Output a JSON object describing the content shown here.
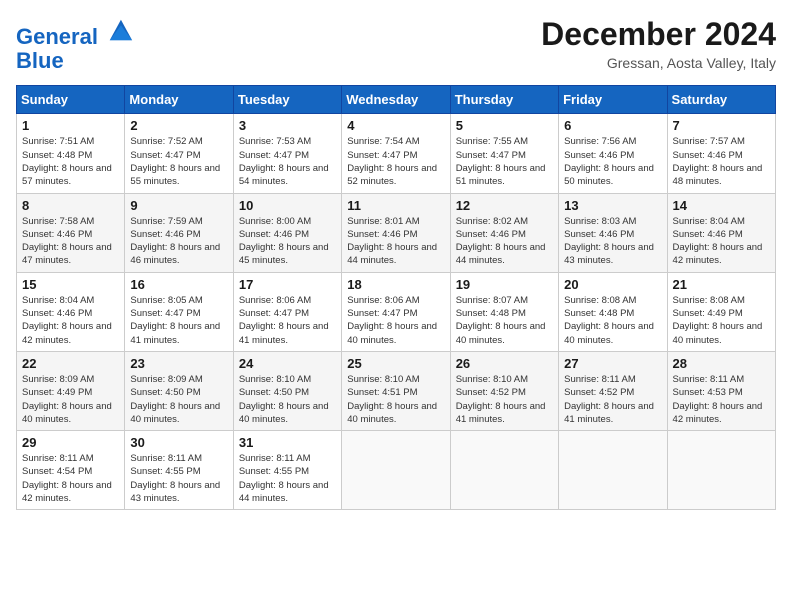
{
  "header": {
    "logo_line1": "General",
    "logo_line2": "Blue",
    "month_title": "December 2024",
    "location": "Gressan, Aosta Valley, Italy"
  },
  "weekdays": [
    "Sunday",
    "Monday",
    "Tuesday",
    "Wednesday",
    "Thursday",
    "Friday",
    "Saturday"
  ],
  "weeks": [
    [
      {
        "day": "1",
        "sunrise": "Sunrise: 7:51 AM",
        "sunset": "Sunset: 4:48 PM",
        "daylight": "Daylight: 8 hours and 57 minutes."
      },
      {
        "day": "2",
        "sunrise": "Sunrise: 7:52 AM",
        "sunset": "Sunset: 4:47 PM",
        "daylight": "Daylight: 8 hours and 55 minutes."
      },
      {
        "day": "3",
        "sunrise": "Sunrise: 7:53 AM",
        "sunset": "Sunset: 4:47 PM",
        "daylight": "Daylight: 8 hours and 54 minutes."
      },
      {
        "day": "4",
        "sunrise": "Sunrise: 7:54 AM",
        "sunset": "Sunset: 4:47 PM",
        "daylight": "Daylight: 8 hours and 52 minutes."
      },
      {
        "day": "5",
        "sunrise": "Sunrise: 7:55 AM",
        "sunset": "Sunset: 4:47 PM",
        "daylight": "Daylight: 8 hours and 51 minutes."
      },
      {
        "day": "6",
        "sunrise": "Sunrise: 7:56 AM",
        "sunset": "Sunset: 4:46 PM",
        "daylight": "Daylight: 8 hours and 50 minutes."
      },
      {
        "day": "7",
        "sunrise": "Sunrise: 7:57 AM",
        "sunset": "Sunset: 4:46 PM",
        "daylight": "Daylight: 8 hours and 48 minutes."
      }
    ],
    [
      {
        "day": "8",
        "sunrise": "Sunrise: 7:58 AM",
        "sunset": "Sunset: 4:46 PM",
        "daylight": "Daylight: 8 hours and 47 minutes."
      },
      {
        "day": "9",
        "sunrise": "Sunrise: 7:59 AM",
        "sunset": "Sunset: 4:46 PM",
        "daylight": "Daylight: 8 hours and 46 minutes."
      },
      {
        "day": "10",
        "sunrise": "Sunrise: 8:00 AM",
        "sunset": "Sunset: 4:46 PM",
        "daylight": "Daylight: 8 hours and 45 minutes."
      },
      {
        "day": "11",
        "sunrise": "Sunrise: 8:01 AM",
        "sunset": "Sunset: 4:46 PM",
        "daylight": "Daylight: 8 hours and 44 minutes."
      },
      {
        "day": "12",
        "sunrise": "Sunrise: 8:02 AM",
        "sunset": "Sunset: 4:46 PM",
        "daylight": "Daylight: 8 hours and 44 minutes."
      },
      {
        "day": "13",
        "sunrise": "Sunrise: 8:03 AM",
        "sunset": "Sunset: 4:46 PM",
        "daylight": "Daylight: 8 hours and 43 minutes."
      },
      {
        "day": "14",
        "sunrise": "Sunrise: 8:04 AM",
        "sunset": "Sunset: 4:46 PM",
        "daylight": "Daylight: 8 hours and 42 minutes."
      }
    ],
    [
      {
        "day": "15",
        "sunrise": "Sunrise: 8:04 AM",
        "sunset": "Sunset: 4:46 PM",
        "daylight": "Daylight: 8 hours and 42 minutes."
      },
      {
        "day": "16",
        "sunrise": "Sunrise: 8:05 AM",
        "sunset": "Sunset: 4:47 PM",
        "daylight": "Daylight: 8 hours and 41 minutes."
      },
      {
        "day": "17",
        "sunrise": "Sunrise: 8:06 AM",
        "sunset": "Sunset: 4:47 PM",
        "daylight": "Daylight: 8 hours and 41 minutes."
      },
      {
        "day": "18",
        "sunrise": "Sunrise: 8:06 AM",
        "sunset": "Sunset: 4:47 PM",
        "daylight": "Daylight: 8 hours and 40 minutes."
      },
      {
        "day": "19",
        "sunrise": "Sunrise: 8:07 AM",
        "sunset": "Sunset: 4:48 PM",
        "daylight": "Daylight: 8 hours and 40 minutes."
      },
      {
        "day": "20",
        "sunrise": "Sunrise: 8:08 AM",
        "sunset": "Sunset: 4:48 PM",
        "daylight": "Daylight: 8 hours and 40 minutes."
      },
      {
        "day": "21",
        "sunrise": "Sunrise: 8:08 AM",
        "sunset": "Sunset: 4:49 PM",
        "daylight": "Daylight: 8 hours and 40 minutes."
      }
    ],
    [
      {
        "day": "22",
        "sunrise": "Sunrise: 8:09 AM",
        "sunset": "Sunset: 4:49 PM",
        "daylight": "Daylight: 8 hours and 40 minutes."
      },
      {
        "day": "23",
        "sunrise": "Sunrise: 8:09 AM",
        "sunset": "Sunset: 4:50 PM",
        "daylight": "Daylight: 8 hours and 40 minutes."
      },
      {
        "day": "24",
        "sunrise": "Sunrise: 8:10 AM",
        "sunset": "Sunset: 4:50 PM",
        "daylight": "Daylight: 8 hours and 40 minutes."
      },
      {
        "day": "25",
        "sunrise": "Sunrise: 8:10 AM",
        "sunset": "Sunset: 4:51 PM",
        "daylight": "Daylight: 8 hours and 40 minutes."
      },
      {
        "day": "26",
        "sunrise": "Sunrise: 8:10 AM",
        "sunset": "Sunset: 4:52 PM",
        "daylight": "Daylight: 8 hours and 41 minutes."
      },
      {
        "day": "27",
        "sunrise": "Sunrise: 8:11 AM",
        "sunset": "Sunset: 4:52 PM",
        "daylight": "Daylight: 8 hours and 41 minutes."
      },
      {
        "day": "28",
        "sunrise": "Sunrise: 8:11 AM",
        "sunset": "Sunset: 4:53 PM",
        "daylight": "Daylight: 8 hours and 42 minutes."
      }
    ],
    [
      {
        "day": "29",
        "sunrise": "Sunrise: 8:11 AM",
        "sunset": "Sunset: 4:54 PM",
        "daylight": "Daylight: 8 hours and 42 minutes."
      },
      {
        "day": "30",
        "sunrise": "Sunrise: 8:11 AM",
        "sunset": "Sunset: 4:55 PM",
        "daylight": "Daylight: 8 hours and 43 minutes."
      },
      {
        "day": "31",
        "sunrise": "Sunrise: 8:11 AM",
        "sunset": "Sunset: 4:55 PM",
        "daylight": "Daylight: 8 hours and 44 minutes."
      },
      null,
      null,
      null,
      null
    ]
  ]
}
